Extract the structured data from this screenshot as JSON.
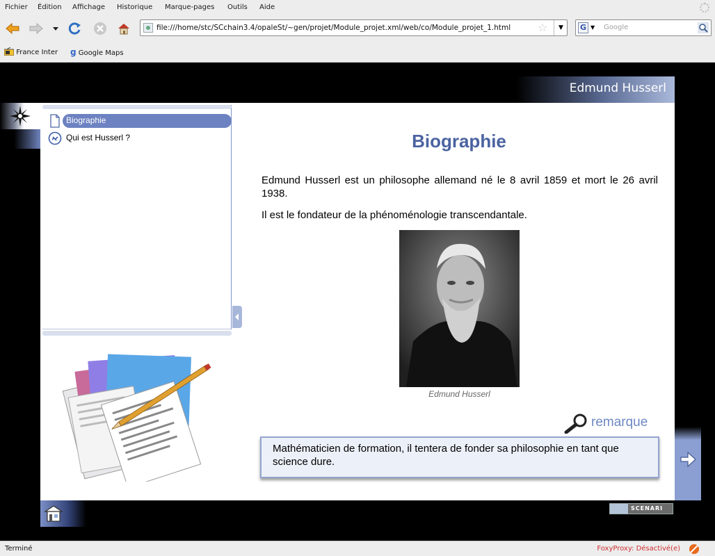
{
  "menubar": {
    "items": [
      "Fichier",
      "Édition",
      "Affichage",
      "Historique",
      "Marque-pages",
      "Outils",
      "Aide"
    ]
  },
  "navbar": {
    "url": "file:///home/stc/SCchain3.4/opaleSt/~gen/projet/Module_projet.xml/web/co/Module_projet_1.html",
    "search_placeholder": "Google",
    "search_engine_icon": "G"
  },
  "bookmarks": {
    "items": [
      {
        "label": "France Inter",
        "icon": "radio-icon"
      },
      {
        "label": "Google Maps",
        "icon": "google-icon"
      }
    ]
  },
  "page": {
    "header_title": "Edmund Husserl",
    "outline": {
      "items": [
        {
          "label": "Biographie",
          "icon": "page-icon",
          "selected": true
        },
        {
          "label": "Qui est Husserl ?",
          "icon": "link-icon",
          "selected": false
        }
      ]
    },
    "content": {
      "title": "Biographie",
      "paragraphs": [
        "Edmund Husserl est un philosophe allemand né le 8 avril 1859 et mort le 26 avril 1938.",
        "Il est le fondateur de la phénoménologie transcendantale."
      ],
      "photo_caption": "Edmund Husserl",
      "remark": {
        "label": "remarque",
        "text": "Mathématicien de formation, il tentera de fonder sa philosophie en tant que science dure."
      }
    },
    "footer_logo": "SCENARI"
  },
  "statusbar": {
    "status": "Terminé",
    "foxyproxy": "FoxyProxy: Désactivé(e)"
  },
  "colors": {
    "accent": "#4b63a1",
    "selection": "#6c82c1",
    "remark_bg": "#ecf0f8"
  }
}
